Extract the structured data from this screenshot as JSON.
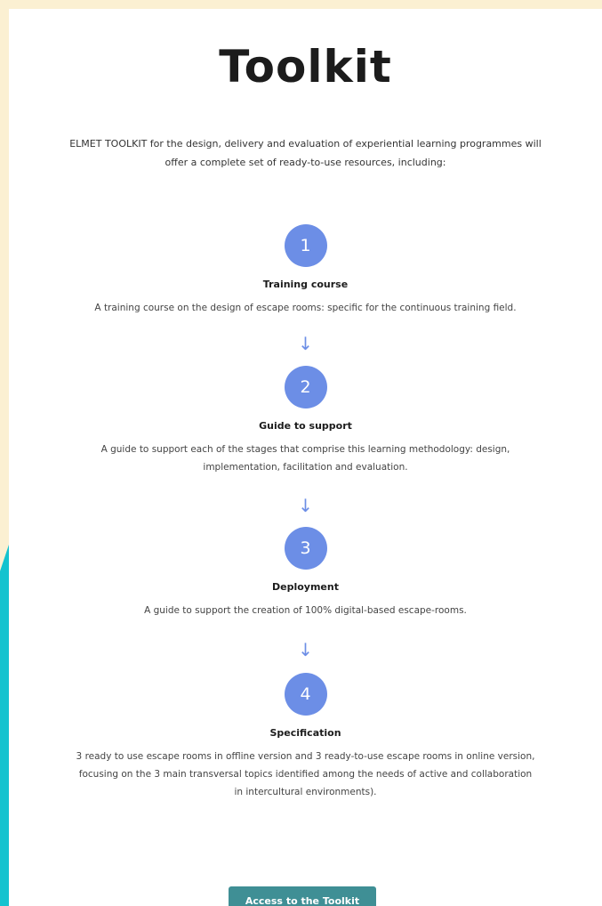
{
  "page": {
    "title": "Toolkit",
    "intro_lines": [
      "ELMET TOOLKIT for the design, delivery and evaluation of experiential learning programmes will",
      "offer a complete set of ready-to-use resources, including:"
    ]
  },
  "steps": [
    {
      "number": "1",
      "title": "Training course",
      "desc_lines": [
        "A training course on the design of escape rooms: specific for the continuous training field."
      ]
    },
    {
      "number": "2",
      "title": "Guide to support",
      "desc_lines": [
        "A guide to support each of the stages that comprise this learning methodology: design,",
        "implementation, facilitation and evaluation."
      ]
    },
    {
      "number": "3",
      "title": "Deployment",
      "desc_lines": [
        "A guide to support the creation of 100% digital-based escape-rooms."
      ]
    },
    {
      "number": "4",
      "title": "Specification",
      "desc_lines": [
        "3 ready to use escape rooms in offline version and 3 ready-to-use escape rooms in online version,",
        "focusing on the 3 main transversal topics identified among the needs of active and collaboration",
        "in intercultural environments)."
      ]
    }
  ],
  "arrow_glyph": "↓",
  "cta": {
    "label": "Access to the Toolkit"
  },
  "colors": {
    "background": "#fbf0d2",
    "accent_teal": "#14c3cf",
    "circle_blue": "#6c8ee6",
    "button": "#3f8f95"
  }
}
